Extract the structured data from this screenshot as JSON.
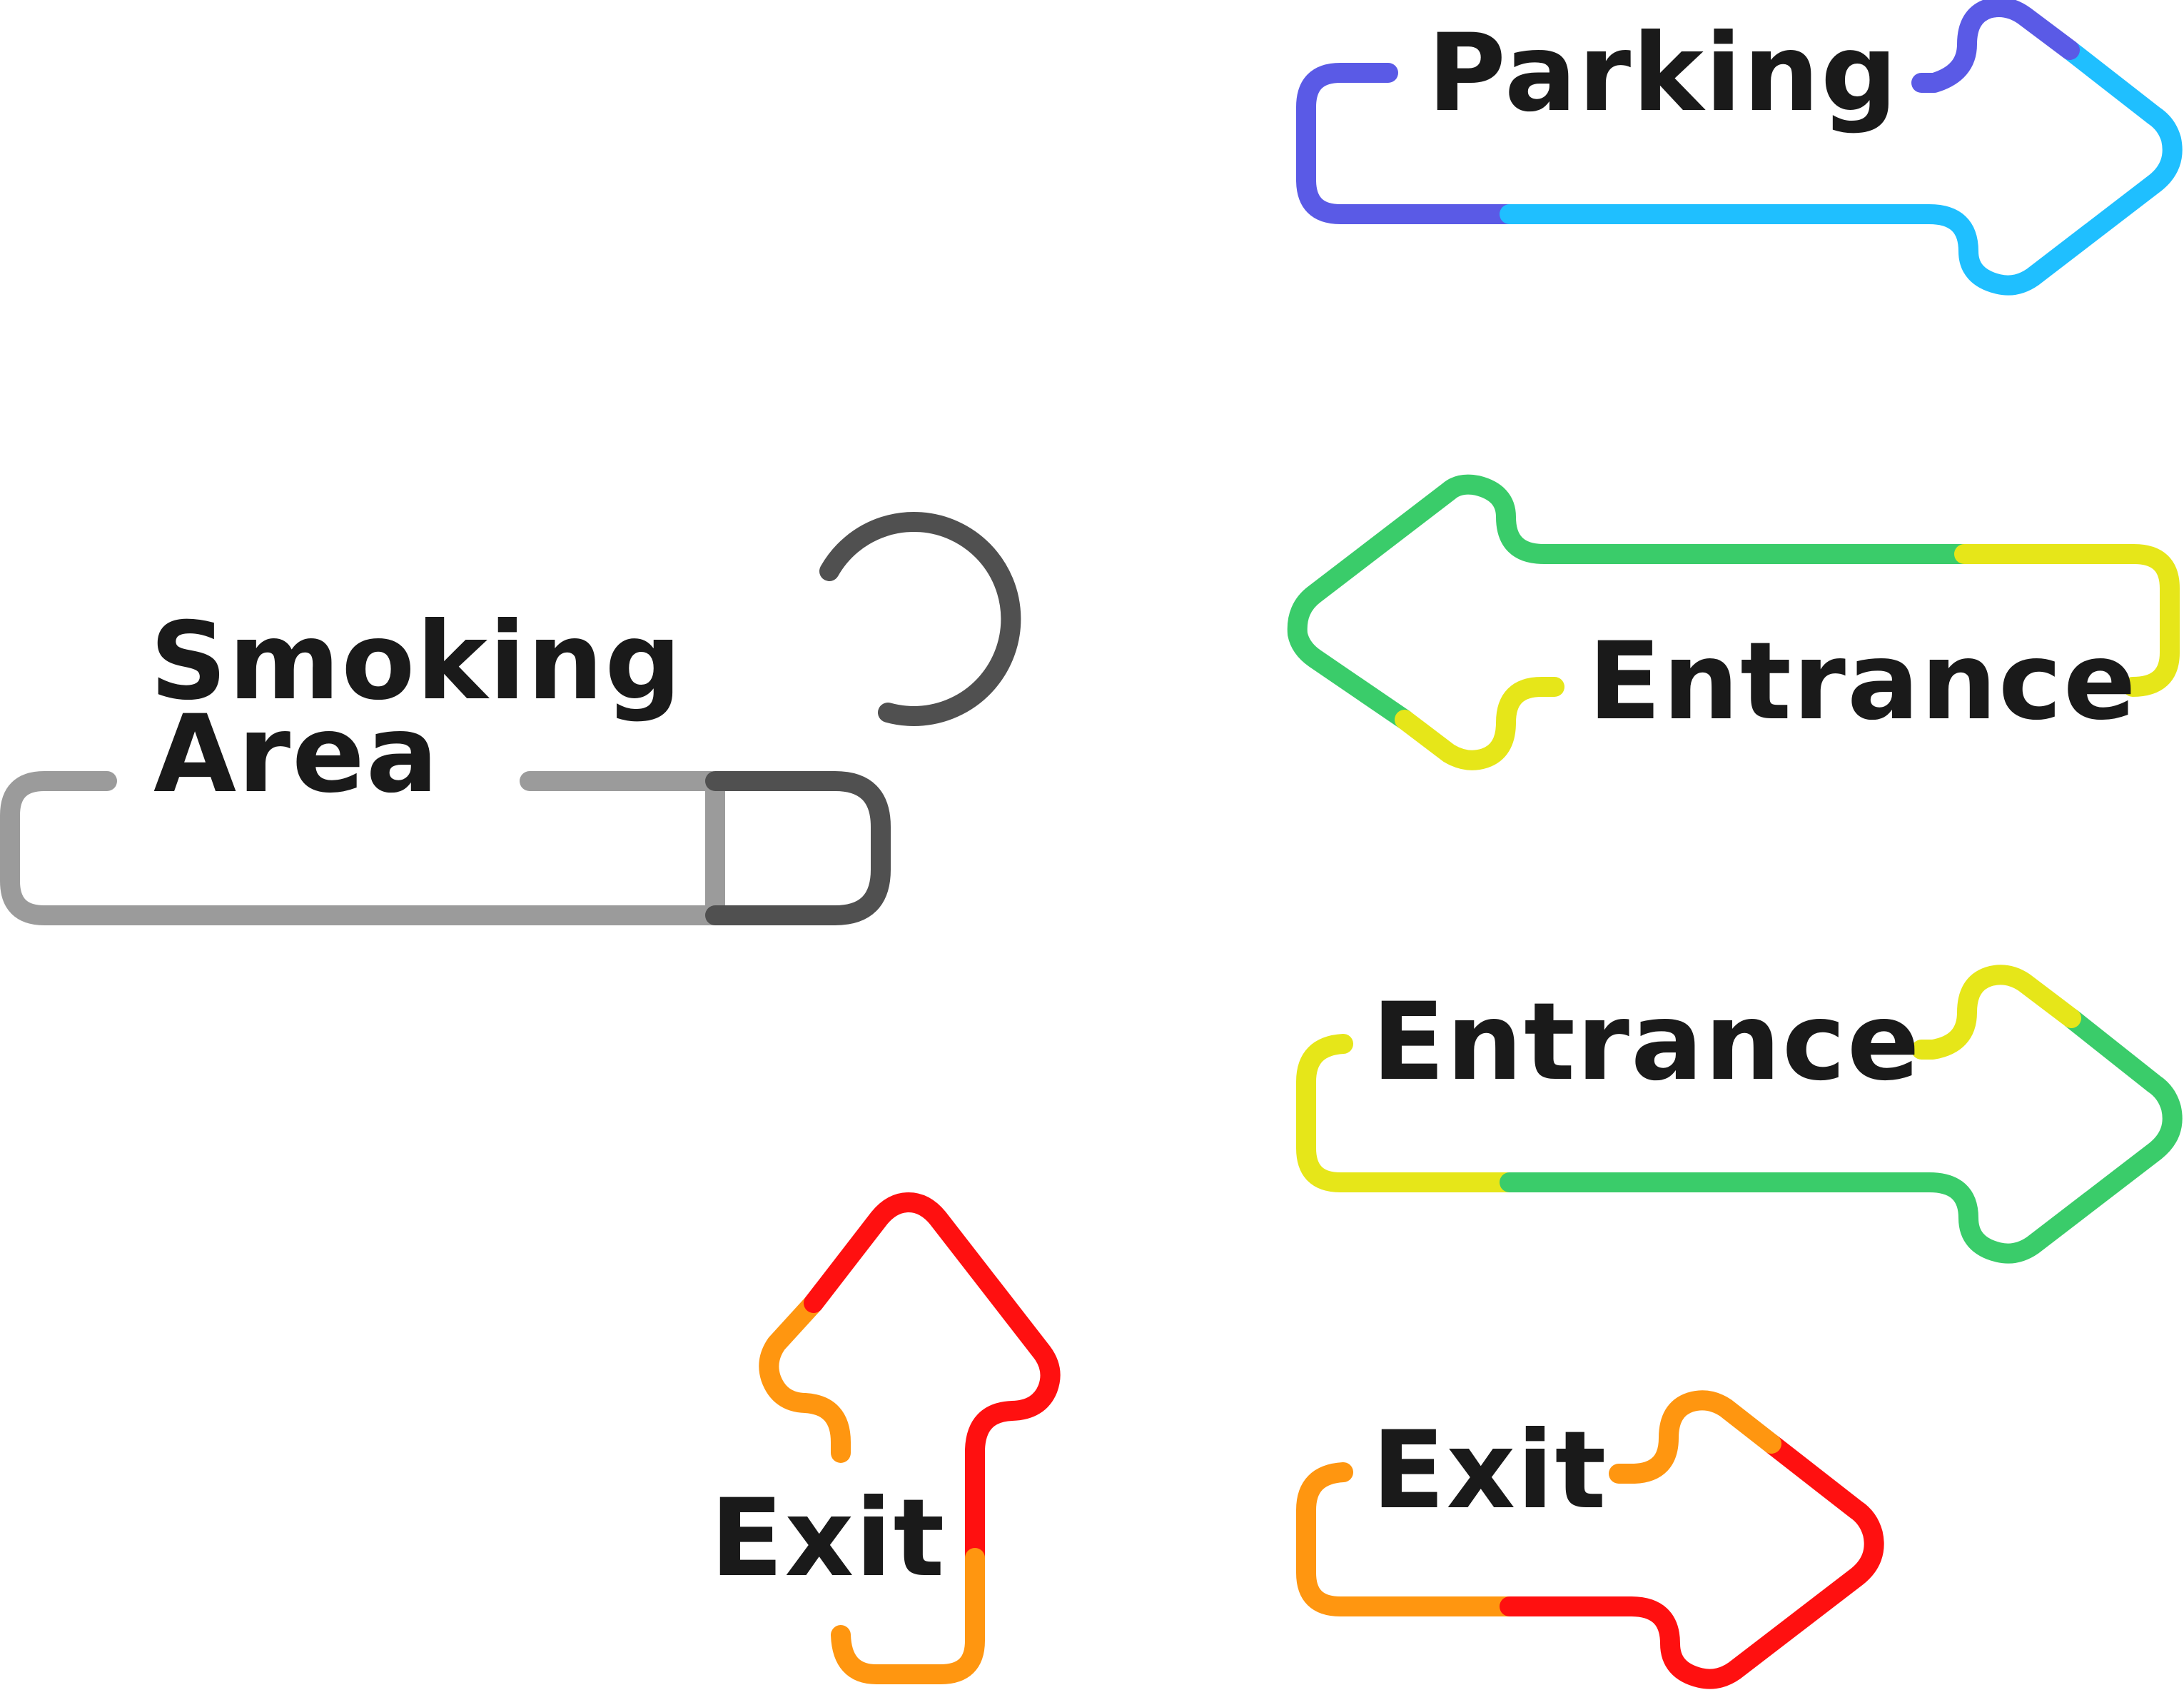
{
  "signs": {
    "parking": {
      "label": "Parking",
      "colors": [
        "#5a5ae6",
        "#1fbfff"
      ],
      "direction": "right"
    },
    "entrance_left": {
      "label": "Entrance",
      "colors": [
        "#3acc6a",
        "#e6e619"
      ],
      "direction": "left"
    },
    "entrance_right": {
      "label": "Entrance",
      "colors": [
        "#e6e619",
        "#3acc6a"
      ],
      "direction": "right"
    },
    "exit_right": {
      "label": "Exit",
      "colors": [
        "#ff9610",
        "#ff1010"
      ],
      "direction": "right"
    },
    "exit_up": {
      "label": "Exit",
      "colors": [
        "#ff9610",
        "#ff1010"
      ],
      "direction": "up"
    },
    "smoking_area": {
      "label_line1": "Smoking",
      "label_line2": "Area",
      "colors": [
        "#9b9b9b",
        "#505050"
      ],
      "icon": "cigarette-with-smoke-icon"
    }
  }
}
